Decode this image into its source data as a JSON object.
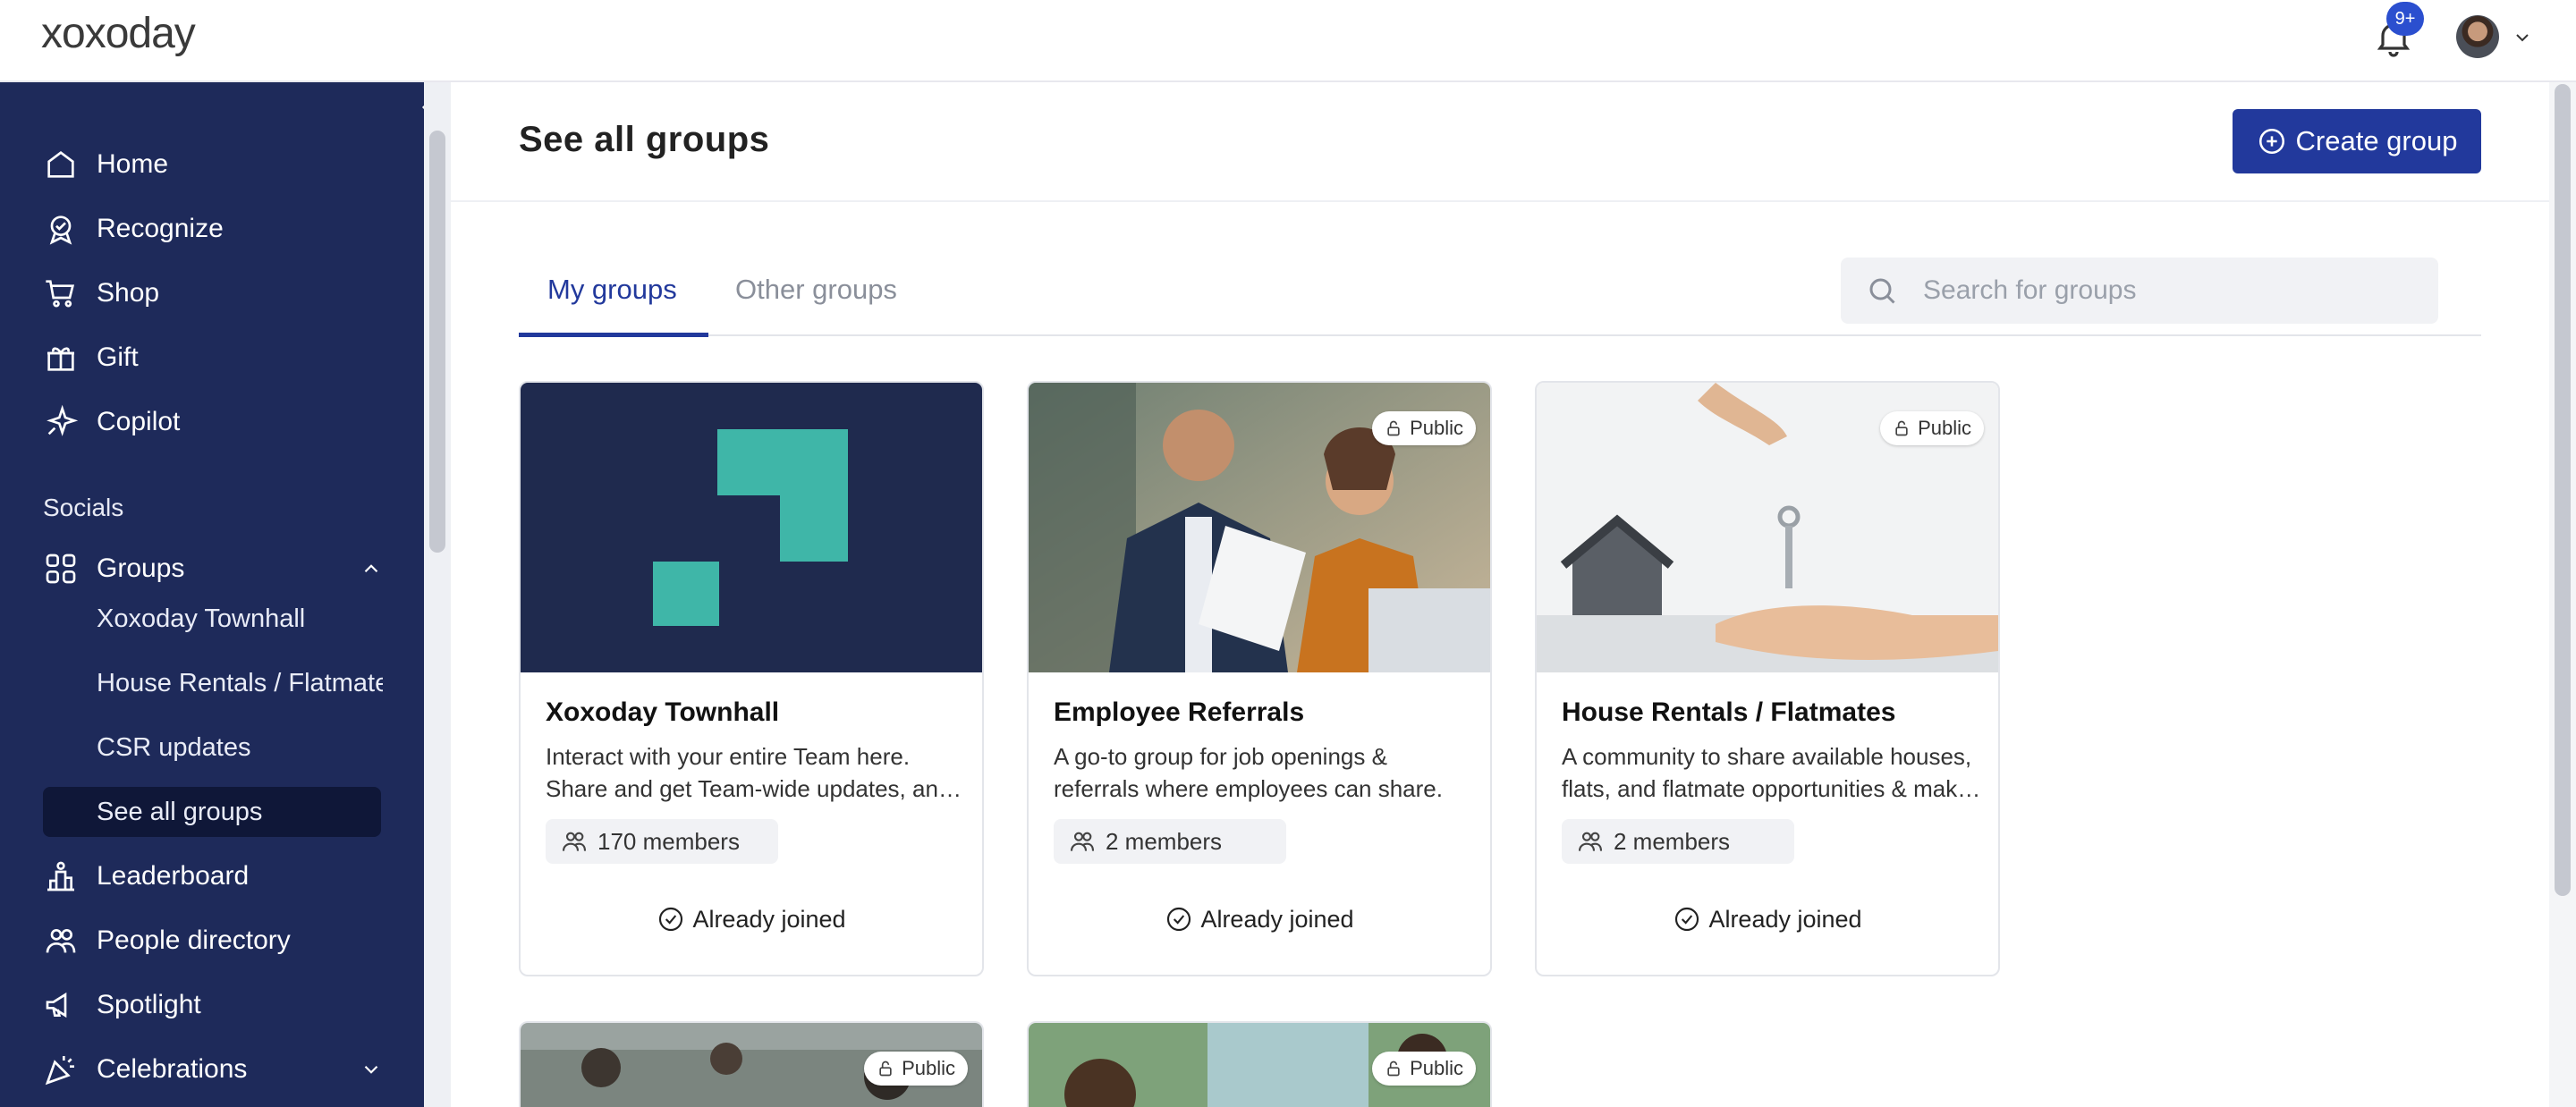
{
  "app": {
    "logo": "xoxoday",
    "notifications_badge": "9+"
  },
  "sidebar": {
    "items": [
      {
        "label": "Home",
        "icon": "home-icon"
      },
      {
        "label": "Recognize",
        "icon": "award-icon"
      },
      {
        "label": "Shop",
        "icon": "cart-icon"
      },
      {
        "label": "Gift",
        "icon": "gift-icon"
      },
      {
        "label": "Copilot",
        "icon": "sparkle-icon"
      }
    ],
    "section": "Socials",
    "groups_label": "Groups",
    "group_items": [
      "Xoxoday Townhall",
      "House Rentals / Flatmates",
      "CSR updates",
      "See all groups"
    ],
    "bottom_items": [
      {
        "label": "Leaderboard",
        "icon": "podium-icon"
      },
      {
        "label": "People directory",
        "icon": "people-icon"
      },
      {
        "label": "Spotlight",
        "icon": "megaphone-icon"
      },
      {
        "label": "Celebrations",
        "icon": "party-icon"
      }
    ]
  },
  "header": {
    "title": "See all groups",
    "create_label": "Create group"
  },
  "tabs": {
    "active": "My groups",
    "other": "Other groups"
  },
  "search": {
    "placeholder": "Search for groups"
  },
  "cards": [
    {
      "title": "Xoxoday Townhall",
      "desc": "Interact with your entire Team here. Share and get Team-wide updates, and more.",
      "members": "170 members",
      "status": "Already joined"
    },
    {
      "title": "Employee Referrals",
      "desc": "A go-to group for job openings & referrals where employees can share.",
      "members": "2 members",
      "status": "Already joined",
      "badge": "Public"
    },
    {
      "title": "House Rentals / Flatmates",
      "desc": "A community to share available houses, flats, and flatmate opportunities & make it easy.",
      "members": "2 members",
      "status": "Already joined",
      "badge": "Public"
    }
  ],
  "more_cards": [
    {
      "badge": "Public"
    },
    {
      "badge": "Public"
    }
  ],
  "colors": {
    "sidebar": "#1e2a5a",
    "accent": "#22399c"
  }
}
